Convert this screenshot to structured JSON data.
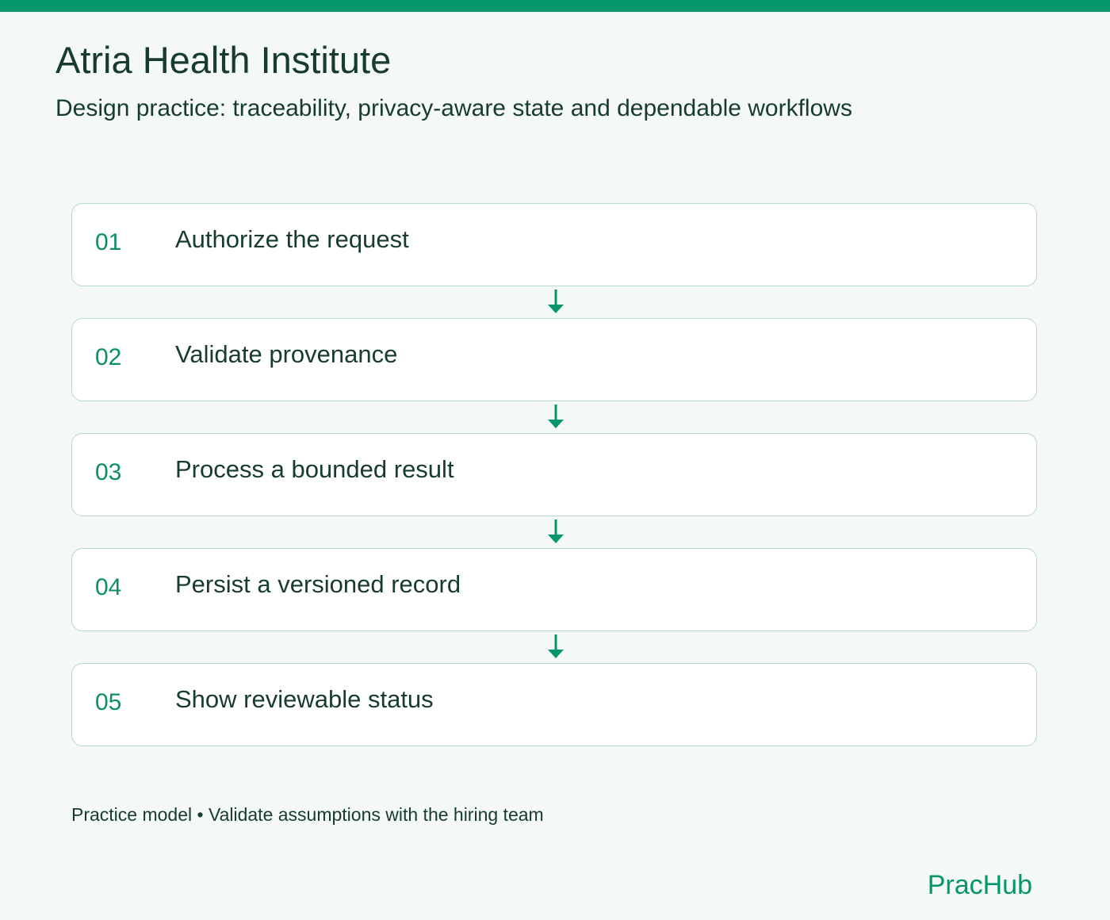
{
  "header": {
    "title": "Atria Health Institute",
    "subtitle": "Design practice: traceability, privacy-aware state and dependable workflows"
  },
  "steps": [
    {
      "number": "01",
      "label": "Authorize the request"
    },
    {
      "number": "02",
      "label": "Validate provenance"
    },
    {
      "number": "03",
      "label": "Process a bounded result"
    },
    {
      "number": "04",
      "label": "Persist a versioned record"
    },
    {
      "number": "05",
      "label": "Show reviewable status"
    }
  ],
  "footer": {
    "note": "Practice model • Validate assumptions with the hiring team",
    "brand": "PracHub"
  },
  "colors": {
    "accent": "#05976b",
    "background": "#f4f8f6",
    "text": "#173a33",
    "card_border": "#b7d8cd"
  },
  "icons": {
    "connector": "arrow-down-icon"
  }
}
